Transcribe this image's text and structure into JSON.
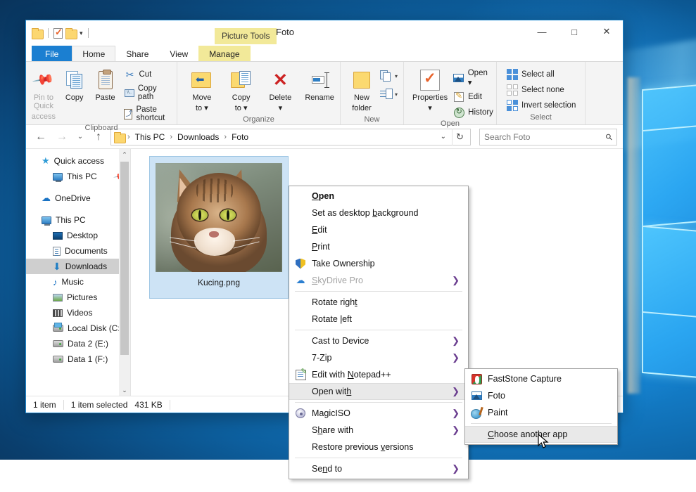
{
  "window": {
    "title": "Foto",
    "contextual_tab_group": "Picture Tools",
    "controls": {
      "minimize": "—",
      "maximize": "□",
      "close": "✕",
      "ribbon_collapse": "⌃",
      "help": "?"
    },
    "quick_access": [
      {
        "name": "new-folder-icon",
        "label": ""
      },
      {
        "name": "properties-icon",
        "label": ""
      },
      {
        "name": "folder-icon",
        "label": ""
      },
      {
        "name": "customize-qat-caret",
        "label": "▾"
      }
    ]
  },
  "tabs": [
    {
      "id": "file",
      "label": "File"
    },
    {
      "id": "home",
      "label": "Home"
    },
    {
      "id": "share",
      "label": "Share"
    },
    {
      "id": "view",
      "label": "View"
    },
    {
      "id": "manage",
      "label": "Manage"
    }
  ],
  "ribbon": {
    "groups": [
      {
        "name": "Clipboard",
        "label": "Clipboard",
        "big": [
          {
            "label1": "Pin to Quick",
            "label2": "access",
            "icon": "pin-icon",
            "disabled": true
          },
          {
            "label1": "Copy",
            "label2": "",
            "icon": "copy-icon",
            "disabled": false
          },
          {
            "label1": "Paste",
            "label2": "",
            "icon": "paste-icon",
            "disabled": false
          }
        ],
        "small": [
          {
            "label": "Cut",
            "icon": "scissors-icon"
          },
          {
            "label": "Copy path",
            "icon": "copy-path-icon"
          },
          {
            "label": "Paste shortcut",
            "icon": "paste-shortcut-icon"
          }
        ]
      },
      {
        "name": "Organize",
        "label": "Organize",
        "big": [
          {
            "label1": "Move",
            "label2": "to ▾",
            "icon": "move-to-icon"
          },
          {
            "label1": "Copy",
            "label2": "to ▾",
            "icon": "copy-to-icon"
          },
          {
            "label1": "Delete",
            "label2": "▾",
            "icon": "delete-icon"
          },
          {
            "label1": "Rename",
            "label2": "",
            "icon": "rename-icon"
          }
        ],
        "small": []
      },
      {
        "name": "New",
        "label": "New",
        "big": [
          {
            "label1": "New",
            "label2": "folder",
            "icon": "new-folder-icon"
          }
        ],
        "small": [
          {
            "label": "",
            "icon": "new-item-icon"
          },
          {
            "label": "",
            "icon": "easy-access-icon"
          }
        ]
      },
      {
        "name": "Open",
        "label": "Open",
        "big": [
          {
            "label1": "Properties",
            "label2": "▾",
            "icon": "properties-icon"
          }
        ],
        "small": [
          {
            "label": "Open ▾",
            "icon": "open-picture-icon"
          },
          {
            "label": "Edit",
            "icon": "edit-icon"
          },
          {
            "label": "History",
            "icon": "history-icon"
          }
        ]
      },
      {
        "name": "Select",
        "label": "Select",
        "big": [],
        "small": [
          {
            "label": "Select all",
            "icon": "select-all-icon"
          },
          {
            "label": "Select none",
            "icon": "select-none-icon"
          },
          {
            "label": "Invert selection",
            "icon": "invert-selection-icon"
          }
        ]
      }
    ]
  },
  "addressbar": {
    "back": "←",
    "forward": "→",
    "recent": "⌄",
    "up": "↑",
    "crumbs": [
      "This PC",
      "Downloads",
      "Foto"
    ],
    "crumb_sep": "›",
    "dropdown_caret": "⌄",
    "refresh": "↻"
  },
  "search": {
    "placeholder": "Search Foto",
    "icon": "search-icon"
  },
  "navpane": {
    "items": [
      {
        "label": "Quick access",
        "icon": "quick-access-star-icon",
        "indent": false,
        "selected": false,
        "pinned": false
      },
      {
        "label": "This PC",
        "icon": "this-pc-monitor-icon",
        "indent": true,
        "selected": false,
        "pinned": true
      },
      {
        "label": "OneDrive",
        "icon": "onedrive-cloud-icon",
        "indent": false,
        "selected": false,
        "pinned": false
      },
      {
        "label": "This PC",
        "icon": "this-pc-monitor-icon",
        "indent": false,
        "selected": false,
        "pinned": false
      },
      {
        "label": "Desktop",
        "icon": "desktop-icon",
        "indent": true,
        "selected": false,
        "pinned": false
      },
      {
        "label": "Documents",
        "icon": "documents-icon",
        "indent": true,
        "selected": false,
        "pinned": false
      },
      {
        "label": "Downloads",
        "icon": "downloads-icon",
        "indent": true,
        "selected": true,
        "pinned": false
      },
      {
        "label": "Music",
        "icon": "music-icon",
        "indent": true,
        "selected": false,
        "pinned": false
      },
      {
        "label": "Pictures",
        "icon": "pictures-icon",
        "indent": true,
        "selected": false,
        "pinned": false
      },
      {
        "label": "Videos",
        "icon": "videos-icon",
        "indent": true,
        "selected": false,
        "pinned": false
      },
      {
        "label": "Local Disk (C:)",
        "icon": "local-disk-icon",
        "indent": true,
        "selected": false,
        "pinned": false
      },
      {
        "label": "Data 2 (E:)",
        "icon": "drive-icon",
        "indent": true,
        "selected": false,
        "pinned": false
      },
      {
        "label": "Data 1 (F:)",
        "icon": "drive-icon",
        "indent": true,
        "selected": false,
        "pinned": false
      }
    ],
    "scroll_up": "⌃",
    "scroll_down": "⌄"
  },
  "file": {
    "name": "Kucing.png"
  },
  "statusbar": {
    "count": "1 item",
    "selection": "1 item selected",
    "size": "431 KB"
  },
  "context_menu": {
    "items": [
      {
        "label": "Open",
        "accel": "O",
        "bold": true,
        "icon": null,
        "arrow": false,
        "disabled": false,
        "highlighted": false,
        "sep_after": false
      },
      {
        "label": "Set as desktop background",
        "accel": "b",
        "bold": false,
        "icon": null,
        "arrow": false,
        "disabled": false,
        "highlighted": false,
        "sep_after": false
      },
      {
        "label": "Edit",
        "accel": "E",
        "bold": false,
        "icon": null,
        "arrow": false,
        "disabled": false,
        "highlighted": false,
        "sep_after": false
      },
      {
        "label": "Print",
        "accel": "P",
        "bold": false,
        "icon": null,
        "arrow": false,
        "disabled": false,
        "highlighted": false,
        "sep_after": false
      },
      {
        "label": "Take Ownership",
        "accel": null,
        "bold": false,
        "icon": "shield-icon",
        "arrow": false,
        "disabled": false,
        "highlighted": false,
        "sep_after": false
      },
      {
        "label": "SkyDrive Pro",
        "accel": "S",
        "bold": false,
        "icon": "cloud-icon",
        "arrow": true,
        "disabled": true,
        "highlighted": false,
        "sep_after": true
      },
      {
        "label": "Rotate right",
        "accel": "t",
        "bold": false,
        "icon": null,
        "arrow": false,
        "disabled": false,
        "highlighted": false,
        "sep_after": false
      },
      {
        "label": "Rotate left",
        "accel": "l",
        "bold": false,
        "icon": null,
        "arrow": false,
        "disabled": false,
        "highlighted": false,
        "sep_after": true
      },
      {
        "label": "Cast to Device",
        "accel": null,
        "bold": false,
        "icon": null,
        "arrow": true,
        "disabled": false,
        "highlighted": false,
        "sep_after": false
      },
      {
        "label": "7-Zip",
        "accel": null,
        "bold": false,
        "icon": null,
        "arrow": true,
        "disabled": false,
        "highlighted": false,
        "sep_after": false
      },
      {
        "label": "Edit with Notepad++",
        "accel": "N",
        "bold": false,
        "icon": "notepadpp-icon",
        "arrow": false,
        "disabled": false,
        "highlighted": false,
        "sep_after": false
      },
      {
        "label": "Open with",
        "accel": "h",
        "bold": false,
        "icon": null,
        "arrow": true,
        "disabled": false,
        "highlighted": true,
        "sep_after": true
      },
      {
        "label": "MagicISO",
        "accel": null,
        "bold": false,
        "icon": "magiciso-icon",
        "arrow": true,
        "disabled": false,
        "highlighted": false,
        "sep_after": false
      },
      {
        "label": "Share with",
        "accel": "h",
        "bold": false,
        "icon": null,
        "arrow": true,
        "disabled": false,
        "highlighted": false,
        "sep_after": false
      },
      {
        "label": "Restore previous versions",
        "accel": "v",
        "bold": false,
        "icon": null,
        "arrow": false,
        "disabled": false,
        "highlighted": false,
        "sep_after": true
      },
      {
        "label": "Send to",
        "accel": "n",
        "bold": false,
        "icon": null,
        "arrow": true,
        "disabled": false,
        "highlighted": false,
        "sep_after": false
      }
    ]
  },
  "submenu": {
    "title": "Open with",
    "items": [
      {
        "label": "FastStone Capture",
        "icon": "faststone-icon",
        "highlighted": false,
        "accel": null,
        "sep_after": false
      },
      {
        "label": "Foto",
        "icon": "foto-icon",
        "highlighted": false,
        "accel": null,
        "sep_after": false
      },
      {
        "label": "Paint",
        "icon": "paint-icon",
        "highlighted": false,
        "accel": null,
        "sep_after": true
      },
      {
        "label": "Choose another app",
        "icon": null,
        "highlighted": true,
        "accel": "C",
        "sep_after": false
      }
    ]
  },
  "colors": {
    "accent": "#1b7fd1",
    "contextual_tab": "#f2e999",
    "selection": "#cde3f5",
    "menu_highlight": "#e9e9e9",
    "submenu_arrow": "#6a3d8f",
    "desktop_blue": "#0d5f9e"
  }
}
